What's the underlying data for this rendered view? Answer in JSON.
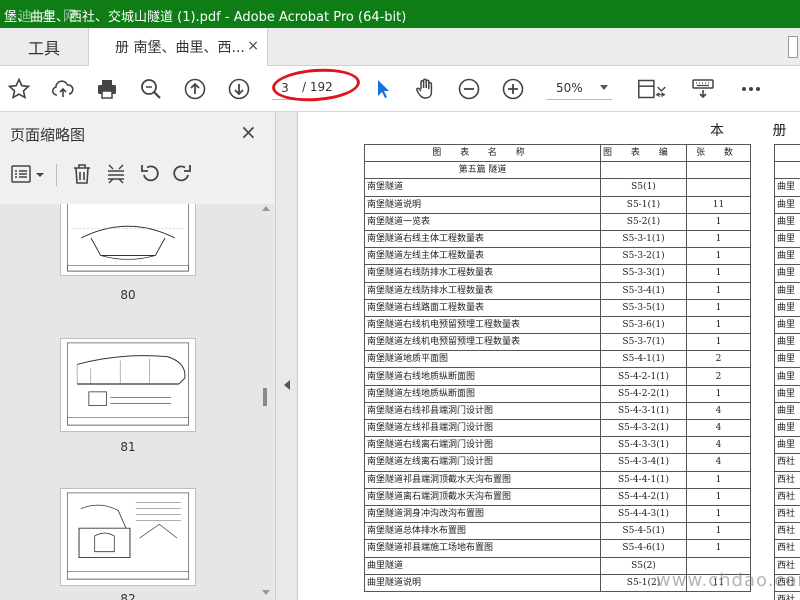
{
  "window": {
    "title": "堡、曲里、西社、交城山隧道 (1).pdf - Adobe Acrobat Pro (64-bit)",
    "watermark": "迪 本 网"
  },
  "tabs": {
    "tools_label": "工具",
    "doc_tab_label": "册 南堡、曲里、西...",
    "doc_tab_close": "×"
  },
  "toolbar": {
    "page_current": "3",
    "page_total": "/ 192",
    "zoom": "50%",
    "icons": [
      "star-icon",
      "cloud-upload-icon",
      "print-icon",
      "search-icon",
      "arrow-up-icon",
      "arrow-down-icon",
      "pointer-icon",
      "hand-icon",
      "zoom-out-icon",
      "zoom-in-icon",
      "page-fit-icon",
      "keyboard-icon",
      "more-icon"
    ]
  },
  "sidepanel": {
    "title": "页面缩略图",
    "close": "×",
    "thumbnails": [
      {
        "page": "80"
      },
      {
        "page": "81"
      },
      {
        "page": "82"
      }
    ]
  },
  "document": {
    "heading": "本 册 目",
    "table_headers": [
      "图 表 名 称",
      "图 表 编 号",
      "张 数"
    ],
    "section_title": "第五篇 隧道",
    "rows": [
      [
        "南堡隧道",
        "S5(1)",
        ""
      ],
      [
        "南堡隧道说明",
        "S5-1(1)",
        "11"
      ],
      [
        "南堡隧道一览表",
        "S5-2(1)",
        "1"
      ],
      [
        "南堡隧道右线主体工程数量表",
        "S5-3-1(1)",
        "1"
      ],
      [
        "南堡隧道左线主体工程数量表",
        "S5-3-2(1)",
        "1"
      ],
      [
        "南堡隧道右线防排水工程数量表",
        "S5-3-3(1)",
        "1"
      ],
      [
        "南堡隧道左线防排水工程数量表",
        "S5-3-4(1)",
        "1"
      ],
      [
        "南堡隧道右线路面工程数量表",
        "S5-3-5(1)",
        "1"
      ],
      [
        "南堡隧道右线机电预留预埋工程数量表",
        "S5-3-6(1)",
        "1"
      ],
      [
        "南堡隧道左线机电预留预埋工程数量表",
        "S5-3-7(1)",
        "1"
      ],
      [
        "南堡隧道地质平面图",
        "S5-4-1(1)",
        "2"
      ],
      [
        "南堡隧道右线地质纵断面图",
        "S5-4-2-1(1)",
        "2"
      ],
      [
        "南堡隧道左线地质纵断面图",
        "S5-4-2-2(1)",
        "1"
      ],
      [
        "南堡隧道右线祁县端洞门设计图",
        "S5-4-3-1(1)",
        "4"
      ],
      [
        "南堡隧道左线祁县端洞门设计图",
        "S5-4-3-2(1)",
        "4"
      ],
      [
        "南堡隧道右线离石端洞门设计图",
        "S5-4-3-3(1)",
        "4"
      ],
      [
        "南堡隧道左线离石端洞门设计图",
        "S5-4-3-4(1)",
        "4"
      ],
      [
        "南堡隧道祁县端洞顶截水天沟布置图",
        "S5-4-4-1(1)",
        "1"
      ],
      [
        "南堡隧道离石端洞顶截水天沟布置图",
        "S5-4-4-2(1)",
        "1"
      ],
      [
        "南堡隧道洞身冲沟改沟布置图",
        "S5-4-4-3(1)",
        "1"
      ],
      [
        "南堡隧道总体排水布置图",
        "S5-4-5(1)",
        "1"
      ],
      [
        "南堡隧道祁县端施工场地布置图",
        "S5-4-6(1)",
        "1"
      ],
      [
        "曲里隧道",
        "S5(2)",
        ""
      ],
      [
        "曲里隧道说明",
        "S5-1(2)",
        "11"
      ]
    ],
    "right_partial": [
      "曲里",
      "曲里",
      "曲里",
      "曲里",
      "曲里",
      "曲里",
      "曲里",
      "曲里",
      "曲里",
      "曲里",
      "曲里",
      "曲里",
      "曲里",
      "曲里",
      "曲里",
      "曲里",
      "西社",
      "西社",
      "西社",
      "西社",
      "西社",
      "西社",
      "西社",
      "西社",
      "西社"
    ],
    "watermark": "www.chdao.com"
  },
  "colors": {
    "titlebar": "#0f7d16",
    "annotation_ellipse": "#e0141e",
    "pointer_active": "#1a6fd8"
  }
}
